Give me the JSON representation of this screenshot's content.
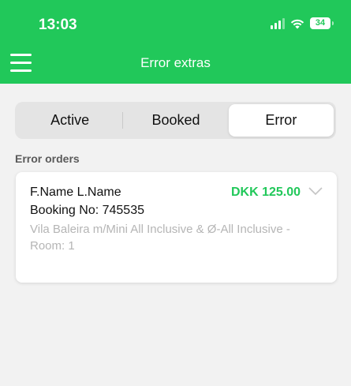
{
  "status_bar": {
    "time": "13:03",
    "battery": "34",
    "icons": [
      "signal-icon",
      "wifi-icon",
      "battery-icon"
    ]
  },
  "header": {
    "title": "Error extras",
    "menu_icon": "hamburger-menu-icon"
  },
  "tabs": [
    {
      "label": "Active",
      "selected": false
    },
    {
      "label": "Booked",
      "selected": false
    },
    {
      "label": "Error",
      "selected": true
    }
  ],
  "section": {
    "label": "Error orders"
  },
  "orders": [
    {
      "name": "F.Name L.Name",
      "amount": "DKK 125.00",
      "booking": "Booking No: 745535",
      "description": "Vila Baleira m/Mini All Inclusive & Ø-All Inclusive - Room: 1"
    }
  ],
  "colors": {
    "brand_green": "#21c85a",
    "background": "#f2f2f2",
    "muted_text": "#b5b5b5"
  }
}
